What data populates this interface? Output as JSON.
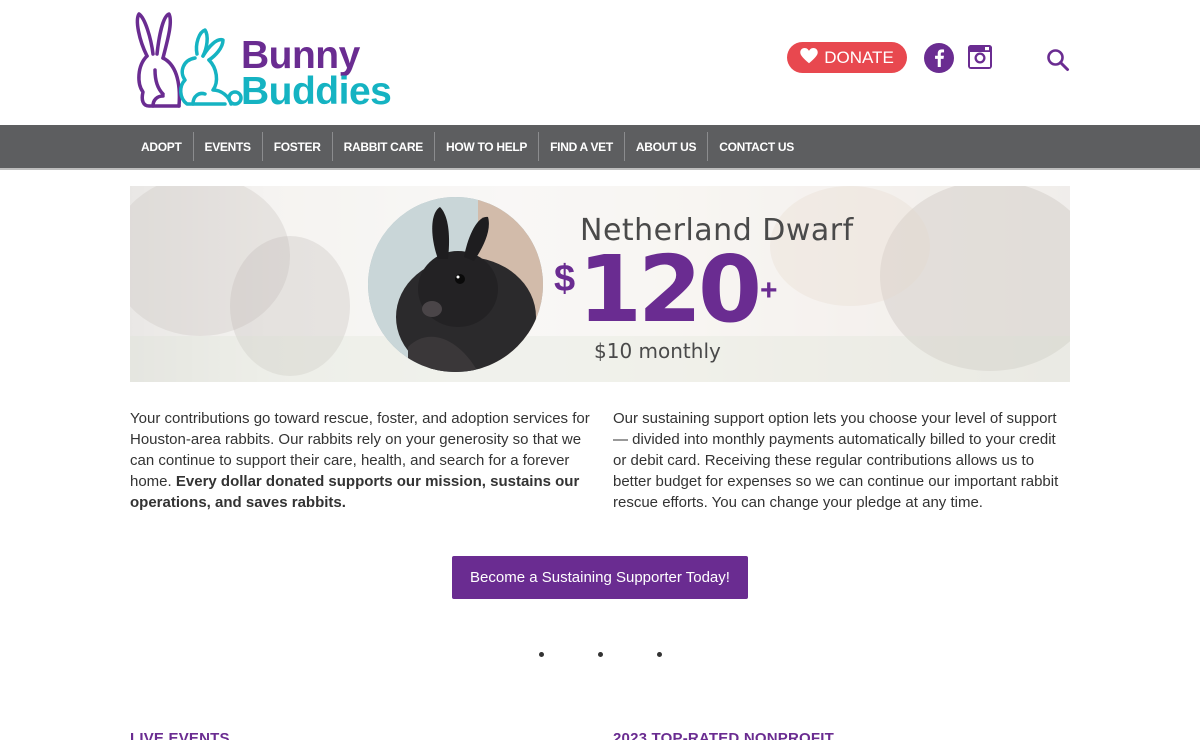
{
  "brand": {
    "line1": "Bunny",
    "line2": "Buddies",
    "primary_color": "#6a2c91",
    "secondary_color": "#15b3c2"
  },
  "header": {
    "donate_label": "DONATE",
    "donate_icon": "heart-icon",
    "facebook_icon": "facebook-icon",
    "instagram_icon": "instagram-icon",
    "search_icon": "search-icon",
    "donate_color": "#e8484f"
  },
  "nav": {
    "items": [
      {
        "label": "ADOPT"
      },
      {
        "label": "EVENTS"
      },
      {
        "label": "FOSTER"
      },
      {
        "label": "RABBIT CARE"
      },
      {
        "label": "HOW TO HELP"
      },
      {
        "label": "FIND A VET"
      },
      {
        "label": "ABOUT US"
      },
      {
        "label": "CONTACT US"
      }
    ]
  },
  "banner": {
    "breed": "Netherland Dwarf",
    "currency": "$",
    "price": "120",
    "plus": "+",
    "monthly": "$10 monthly"
  },
  "content": {
    "left_text": "Your contributions go toward rescue, foster, and adoption services for Houston-area rabbits. Our rabbits rely on your generosity so that we can continue to support their care, health, and search for a forever home.",
    "left_bold": "Every dollar donated supports our mission, sustains our operations, and saves rabbits.",
    "right_text": "Our sustaining support option lets you choose your level of support — divided into monthly payments automatically billed to your credit or debit card. Receiving these regular contributions allows us to better budget for expenses so we can continue our important rabbit rescue efforts. You can change your pledge at any time.",
    "cta_label": "Become a Sustaining Supporter Today!"
  },
  "footer_sections": {
    "left_title": "LIVE EVENTS",
    "right_title": "2023 TOP-RATED NONPROFIT"
  }
}
